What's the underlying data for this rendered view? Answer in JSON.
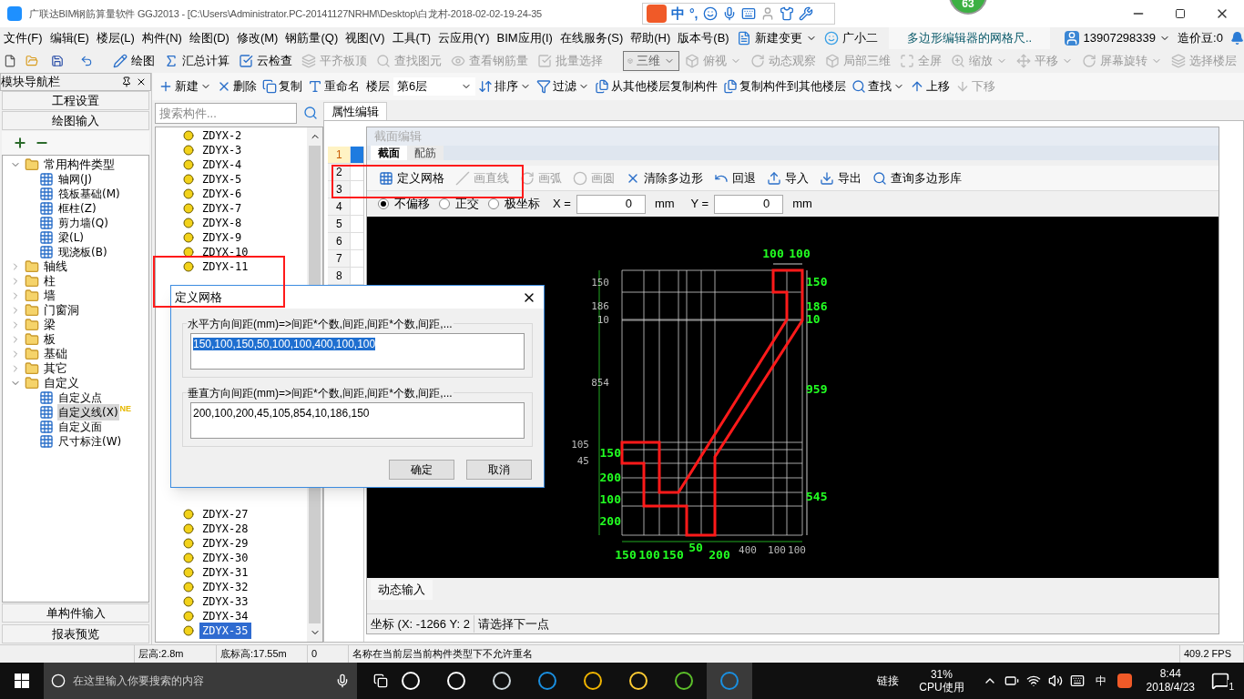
{
  "window": {
    "title": "广联达BIM钢筋算量软件 GGJ2013 - [C:\\Users\\Administrator.PC-20141127NRHM\\Desktop\\白龙村-2018-02-02-19-24-35"
  },
  "ime": {
    "lang": "中",
    "punct": "°,"
  },
  "badge": "63",
  "menu": [
    "文件(F)",
    "编辑(E)",
    "楼层(L)",
    "构件(N)",
    "绘图(D)",
    "修改(M)",
    "钢筋量(Q)",
    "视图(V)",
    "工具(T)",
    "云应用(Y)",
    "BIM应用(I)",
    "在线服务(S)",
    "帮助(H)",
    "版本号(B)"
  ],
  "menu_extras": {
    "change": "新建变更",
    "assistant": "广小二",
    "doc_tab": "多边形编辑器的网格尺..",
    "account": "13907298339",
    "beans": "造价豆:0"
  },
  "toolbar": [
    {
      "label": "绘图",
      "disabled": false
    },
    {
      "label": "汇总计算",
      "disabled": false
    },
    {
      "label": "云检查",
      "disabled": false
    },
    {
      "label": "平齐板顶",
      "disabled": true
    },
    {
      "label": "查找图元",
      "disabled": true
    },
    {
      "label": "查看钢筋量",
      "disabled": true
    },
    {
      "label": "批量选择",
      "disabled": true
    }
  ],
  "view_select": "三维",
  "view_tools": [
    {
      "label": "俯视",
      "disabled": true,
      "dropdown": true
    },
    {
      "label": "动态观察",
      "disabled": true,
      "dropdown": false
    },
    {
      "label": "局部三维",
      "disabled": true,
      "dropdown": false
    },
    {
      "label": "全屏",
      "disabled": true,
      "dropdown": false
    },
    {
      "label": "缩放",
      "disabled": true,
      "dropdown": true
    },
    {
      "label": "平移",
      "disabled": true,
      "dropdown": true
    },
    {
      "label": "屏幕旋转",
      "disabled": true,
      "dropdown": true
    },
    {
      "label": "选择楼层",
      "disabled": true,
      "dropdown": false
    }
  ],
  "nav": {
    "title": "模块导航栏",
    "top_buttons": [
      "工程设置",
      "绘图输入"
    ],
    "bottom_buttons": [
      "单构件输入",
      "报表预览"
    ],
    "tree": [
      {
        "label": "常用构件类型",
        "expanded": true,
        "selected": false,
        "children": [
          {
            "label": "轴网(J)",
            "selected": false
          },
          {
            "label": "筏板基础(M)",
            "selected": false
          },
          {
            "label": "框柱(Z)",
            "selected": false
          },
          {
            "label": "剪力墙(Q)",
            "selected": false
          },
          {
            "label": "梁(L)",
            "selected": false
          },
          {
            "label": "现浇板(B)",
            "selected": false
          }
        ]
      },
      {
        "label": "轴线",
        "expanded": false,
        "selected": false
      },
      {
        "label": "柱",
        "expanded": false,
        "selected": false
      },
      {
        "label": "墙",
        "expanded": false,
        "selected": false
      },
      {
        "label": "门窗洞",
        "expanded": false,
        "selected": false
      },
      {
        "label": "梁",
        "expanded": false,
        "selected": false
      },
      {
        "label": "板",
        "expanded": false,
        "selected": false
      },
      {
        "label": "基础",
        "expanded": false,
        "selected": false
      },
      {
        "label": "其它",
        "expanded": false,
        "selected": false
      },
      {
        "label": "自定义",
        "expanded": true,
        "selected": false,
        "children": [
          {
            "label": "自定义点",
            "selected": false
          },
          {
            "label": "自定义线(X)",
            "selected": true,
            "badge": "NE"
          },
          {
            "label": "自定义面",
            "selected": false
          },
          {
            "label": "尺寸标注(W)",
            "selected": false
          }
        ]
      }
    ]
  },
  "component_toolbar": {
    "items": [
      {
        "label": "新建",
        "dropdown": true,
        "disabled": false
      },
      {
        "label": "删除",
        "dropdown": false,
        "disabled": false
      },
      {
        "label": "复制",
        "dropdown": false,
        "disabled": false
      },
      {
        "label": "重命名",
        "dropdown": false,
        "disabled": false
      }
    ],
    "floor_label": "楼层",
    "floor": "第6层",
    "items2": [
      {
        "label": "排序",
        "dropdown": true,
        "disabled": false
      },
      {
        "label": "过滤",
        "dropdown": true,
        "disabled": false
      },
      {
        "label": "从其他楼层复制构件",
        "dropdown": false,
        "disabled": false
      },
      {
        "label": "复制构件到其他楼层",
        "dropdown": false,
        "disabled": false
      },
      {
        "label": "查找",
        "dropdown": true,
        "disabled": false
      },
      {
        "label": "上移",
        "dropdown": false,
        "disabled": false
      },
      {
        "label": "下移",
        "dropdown": false,
        "disabled": true
      }
    ]
  },
  "component_search": {
    "placeholder": "搜索构件..."
  },
  "components_top": [
    {
      "label": "ZDYX-2",
      "selected": false
    },
    {
      "label": "ZDYX-3",
      "selected": false
    },
    {
      "label": "ZDYX-4",
      "selected": false
    },
    {
      "label": "ZDYX-5",
      "selected": false
    },
    {
      "label": "ZDYX-6",
      "selected": false
    },
    {
      "label": "ZDYX-7",
      "selected": false
    },
    {
      "label": "ZDYX-8",
      "selected": false
    },
    {
      "label": "ZDYX-9",
      "selected": false
    },
    {
      "label": "ZDYX-10",
      "selected": false
    },
    {
      "label": "ZDYX-11",
      "selected": false
    }
  ],
  "components_bottom": [
    {
      "label": "ZDYX-27",
      "selected": false
    },
    {
      "label": "ZDYX-28",
      "selected": false
    },
    {
      "label": "ZDYX-29",
      "selected": false
    },
    {
      "label": "ZDYX-30",
      "selected": false
    },
    {
      "label": "ZDYX-31",
      "selected": false
    },
    {
      "label": "ZDYX-32",
      "selected": false
    },
    {
      "label": "ZDYX-33",
      "selected": false
    },
    {
      "label": "ZDYX-34",
      "selected": false
    },
    {
      "label": "ZDYX-35",
      "selected": true
    }
  ],
  "property_tab": "属性编辑",
  "row_numbers": [
    {
      "label": "1",
      "selected": true
    },
    {
      "label": "2",
      "selected": false
    },
    {
      "label": "3",
      "selected": false
    },
    {
      "label": "4",
      "selected": false
    },
    {
      "label": "5",
      "selected": false
    },
    {
      "label": "6",
      "selected": false
    },
    {
      "label": "7",
      "selected": false
    },
    {
      "label": "8",
      "selected": false
    }
  ],
  "editor": {
    "title": "截面编辑",
    "tabs": [
      {
        "label": "截面",
        "selected": true
      },
      {
        "label": "配筋",
        "selected": false
      }
    ],
    "tools": [
      {
        "label": "定义网格",
        "disabled": false
      },
      {
        "label": "画直线",
        "disabled": true
      },
      {
        "label": "画弧",
        "disabled": true
      },
      {
        "label": "画圆",
        "disabled": true
      },
      {
        "label": "清除多边形",
        "disabled": false
      },
      {
        "label": "回退",
        "disabled": false
      },
      {
        "label": "导入",
        "disabled": false
      },
      {
        "label": "导出",
        "disabled": false
      },
      {
        "label": "查询多边形库",
        "disabled": false
      }
    ],
    "modes": [
      {
        "label": "不偏移",
        "selected": true
      },
      {
        "label": "正交",
        "selected": false
      },
      {
        "label": "极坐标",
        "selected": false
      }
    ],
    "x_label": "X =",
    "x_value": "0",
    "x_unit": "mm",
    "y_label": "Y =",
    "y_value": "0",
    "y_unit": "mm",
    "cad_drawing": {
      "left_grid_labels": [
        "150",
        "186",
        "10",
        "854",
        "105",
        "45"
      ],
      "left_dims": [
        "150",
        "200",
        "100",
        "200"
      ],
      "right_dims": [
        "150",
        "186",
        "10",
        "959",
        "545"
      ],
      "top_dims": [
        "100",
        "100"
      ],
      "bottom_dims": [
        "150",
        "100",
        "150",
        "50",
        "200"
      ],
      "bottom_grid_labels": [
        "400",
        "100",
        "100"
      ]
    },
    "input_tab": "动态输入",
    "coords": "坐标 (X: -1266 Y: 2",
    "prompt": "请选择下一点"
  },
  "dialog": {
    "title": "定义网格",
    "groups": [
      {
        "label": "水平方向间距(mm)=>间距*个数,间距,间距*个数,间距,...",
        "value": "150,100,150,50,100,100,400,100,100",
        "selected": true
      },
      {
        "label": "垂直方向间距(mm)=>间距*个数,间距,间距*个数,间距,...",
        "value": "200,100,200,45,105,854,10,186,150",
        "selected": false
      }
    ],
    "buttons": [
      "确定",
      "取消"
    ]
  },
  "status_bar": [
    "层高:2.8m",
    "底标高:17.55m",
    "0",
    "名称在当前层当前构件类型下不允许重名",
    "409.2 FPS"
  ],
  "taskbar": {
    "search_placeholder": "在这里输入你要搜索的内容",
    "link": "链接",
    "cpu": "31%",
    "cpu_label": "CPU使用",
    "ime": "中",
    "time": "8:44",
    "date": "2018/4/23",
    "notifications": "1"
  }
}
